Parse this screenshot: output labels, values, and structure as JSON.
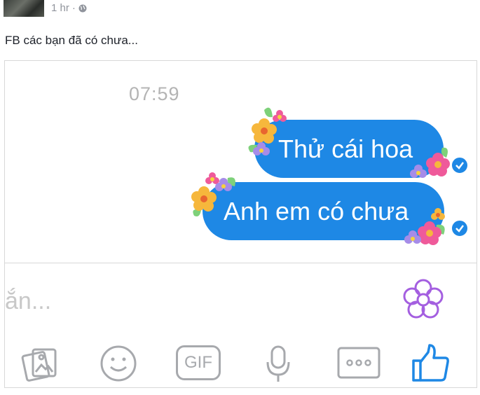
{
  "post": {
    "time": "1 hr",
    "separator": "·",
    "caption": "FB các bạn đã có chưa..."
  },
  "chat": {
    "timestamp": "07:59",
    "messages": [
      {
        "text": "Thử cái hoa",
        "status": "sent"
      },
      {
        "text": "Anh em có chưa",
        "status": "sent"
      }
    ]
  },
  "composer": {
    "placeholder_partial": "ắn..."
  },
  "toolbar": {
    "gif_label": "GIF",
    "items": [
      "photo-icon",
      "emoji-icon",
      "gif-button",
      "microphone-icon",
      "more-icon",
      "like-thumb-icon"
    ]
  },
  "colors": {
    "bubble": "#1e88e5",
    "timestamp": "#b4b4b4",
    "toolbar_icon": "#a7a9ad",
    "like": "#1e88e5",
    "flower_button": "#a45fe0"
  }
}
